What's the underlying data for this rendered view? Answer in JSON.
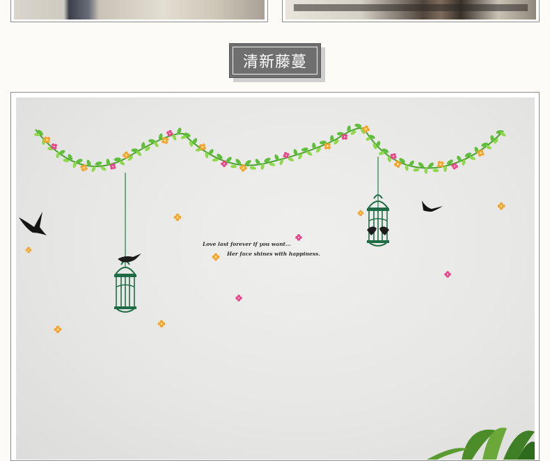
{
  "section": {
    "title": "清新藤蔓"
  },
  "decal": {
    "quote_line1": "Love last forever if you want...",
    "quote_line2": "Her face shines with happiness."
  },
  "colors": {
    "tag_background": "#6f6f6f",
    "vine_green": "#5fbf3a",
    "flower_pink": "#e8478a",
    "flower_orange": "#f4a531",
    "cage_green": "#1f6b45"
  },
  "icons": {
    "bird": "bird-icon",
    "birdcage": "birdcage-icon",
    "flower": "flower-icon",
    "plant": "plant-icon"
  }
}
